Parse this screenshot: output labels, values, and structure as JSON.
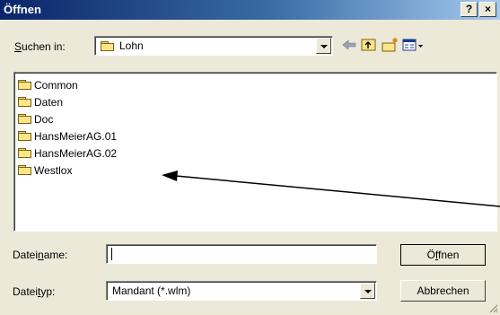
{
  "window": {
    "title": "Öffnen",
    "help_btn": "?",
    "close_btn": "×"
  },
  "lookin": {
    "label_pre": "",
    "label_u": "S",
    "label_post": "uchen in:",
    "value": "Lohn"
  },
  "files": [
    {
      "name": "Common"
    },
    {
      "name": "Daten"
    },
    {
      "name": "Doc"
    },
    {
      "name": "HansMeierAG.01"
    },
    {
      "name": "HansMeierAG.02"
    },
    {
      "name": "Westlox"
    }
  ],
  "filename": {
    "label_pre": "Datei",
    "label_u": "n",
    "label_post": "ame:",
    "value": ""
  },
  "filetype": {
    "label_pre": "Datei",
    "label_u": "t",
    "label_post": "yp:",
    "value": "Mandant (*.wlm)"
  },
  "buttons": {
    "open_pre": "Ö",
    "open_u": "f",
    "open_post": "fnen",
    "cancel": "Abbrechen"
  },
  "icons": {
    "back": "back-arrow-icon",
    "up": "up-folder-icon",
    "new_folder": "new-folder-icon",
    "view_menu": "view-menu-icon"
  },
  "colors": {
    "title_start": "#0a246a",
    "title_end": "#a6caf0",
    "face": "#ece9d8",
    "folder": "#fce588"
  }
}
